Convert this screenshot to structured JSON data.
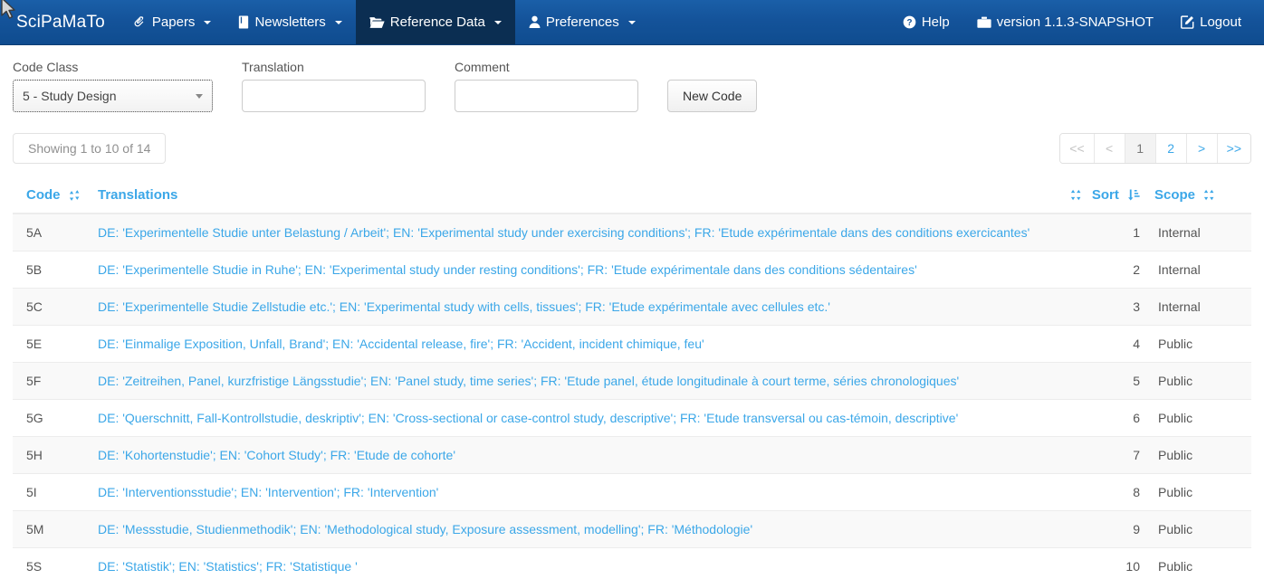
{
  "navbar": {
    "brand": "SciPaMaTo",
    "items": [
      {
        "label": "Papers",
        "icon": "paperclip-icon",
        "caret": true,
        "active": false
      },
      {
        "label": "Newsletters",
        "icon": "book-icon",
        "caret": true,
        "active": false
      },
      {
        "label": "Reference Data",
        "icon": "folder-icon",
        "caret": true,
        "active": true
      },
      {
        "label": "Preferences",
        "icon": "user-icon",
        "caret": true,
        "active": false
      }
    ],
    "right_items": [
      {
        "label": "Help",
        "icon": "question-circle-icon"
      },
      {
        "label": "version 1.1.3-SNAPSHOT",
        "icon": "briefcase-icon"
      },
      {
        "label": "Logout",
        "icon": "pencil-square-icon"
      }
    ]
  },
  "form": {
    "code_class": {
      "label": "Code Class",
      "value": "5 - Study Design"
    },
    "translation": {
      "label": "Translation",
      "value": "",
      "placeholder": ""
    },
    "comment": {
      "label": "Comment",
      "value": "",
      "placeholder": ""
    },
    "new_code_button": "New Code"
  },
  "results": {
    "showing": "Showing 1 to 10 of 14",
    "pagination": [
      {
        "label": "<<",
        "state": "disabled"
      },
      {
        "label": "<",
        "state": "disabled"
      },
      {
        "label": "1",
        "state": "active"
      },
      {
        "label": "2",
        "state": "link"
      },
      {
        "label": ">",
        "state": "link"
      },
      {
        "label": ">>",
        "state": "link"
      }
    ]
  },
  "table": {
    "headers": [
      {
        "label": "Code",
        "icon": "sort-icon"
      },
      {
        "label": "Translations",
        "icon": ""
      },
      {
        "label": "Sort",
        "icon": "sort-amount-asc-icon",
        "pre_icon": "sort-icon"
      },
      {
        "label": "Scope",
        "icon": "sort-icon"
      }
    ],
    "rows": [
      {
        "code": "5A",
        "translations": "DE: 'Experimentelle Studie unter Belastung / Arbeit'; EN: 'Experimental study under exercising conditions'; FR: 'Etude expérimentale dans des conditions exercicantes'",
        "sort": "1",
        "scope": "Internal"
      },
      {
        "code": "5B",
        "translations": "DE: 'Experimentelle Studie in Ruhe'; EN: 'Experimental study under resting conditions'; FR: 'Etude expérimentale dans des conditions sédentaires'",
        "sort": "2",
        "scope": "Internal"
      },
      {
        "code": "5C",
        "translations": "DE: 'Experimentelle Studie Zellstudie etc.'; EN: 'Experimental study with cells, tissues'; FR: 'Etude expérimentale avec cellules etc.'",
        "sort": "3",
        "scope": "Internal"
      },
      {
        "code": "5E",
        "translations": "DE: 'Einmalige Exposition, Unfall, Brand'; EN: 'Accidental release, fire'; FR: 'Accident, incident chimique, feu'",
        "sort": "4",
        "scope": "Public"
      },
      {
        "code": "5F",
        "translations": "DE: 'Zeitreihen, Panel, kurzfristige Längsstudie'; EN: 'Panel study, time series'; FR: 'Etude panel, étude longitudinale à court terme, séries chronologiques'",
        "sort": "5",
        "scope": "Public"
      },
      {
        "code": "5G",
        "translations": "DE: 'Querschnitt, Fall-Kontrollstudie, deskriptiv'; EN: 'Cross-sectional or case-control study, descriptive'; FR: 'Etude transversal ou cas-témoin, descriptive'",
        "sort": "6",
        "scope": "Public"
      },
      {
        "code": "5H",
        "translations": "DE: 'Kohortenstudie'; EN: 'Cohort Study'; FR: 'Etude de cohorte'",
        "sort": "7",
        "scope": "Public"
      },
      {
        "code": "5I",
        "translations": "DE: 'Interventionsstudie'; EN: 'Intervention'; FR: 'Intervention'",
        "sort": "8",
        "scope": "Public"
      },
      {
        "code": "5M",
        "translations": "DE: 'Messstudie, Studienmethodik'; EN: 'Methodological study, Exposure assessment, modelling'; FR: 'Méthodologie'",
        "sort": "9",
        "scope": "Public"
      },
      {
        "code": "5S",
        "translations": "DE: 'Statistik'; EN: 'Statistics'; FR: 'Statistique '",
        "sort": "10",
        "scope": "Public"
      }
    ]
  },
  "colors": {
    "navbar_blue": "#14539a",
    "navbar_active": "#0b2e52",
    "link_blue": "#3ba7e8",
    "row_alt": "#f9f9f9",
    "text": "#555555"
  }
}
